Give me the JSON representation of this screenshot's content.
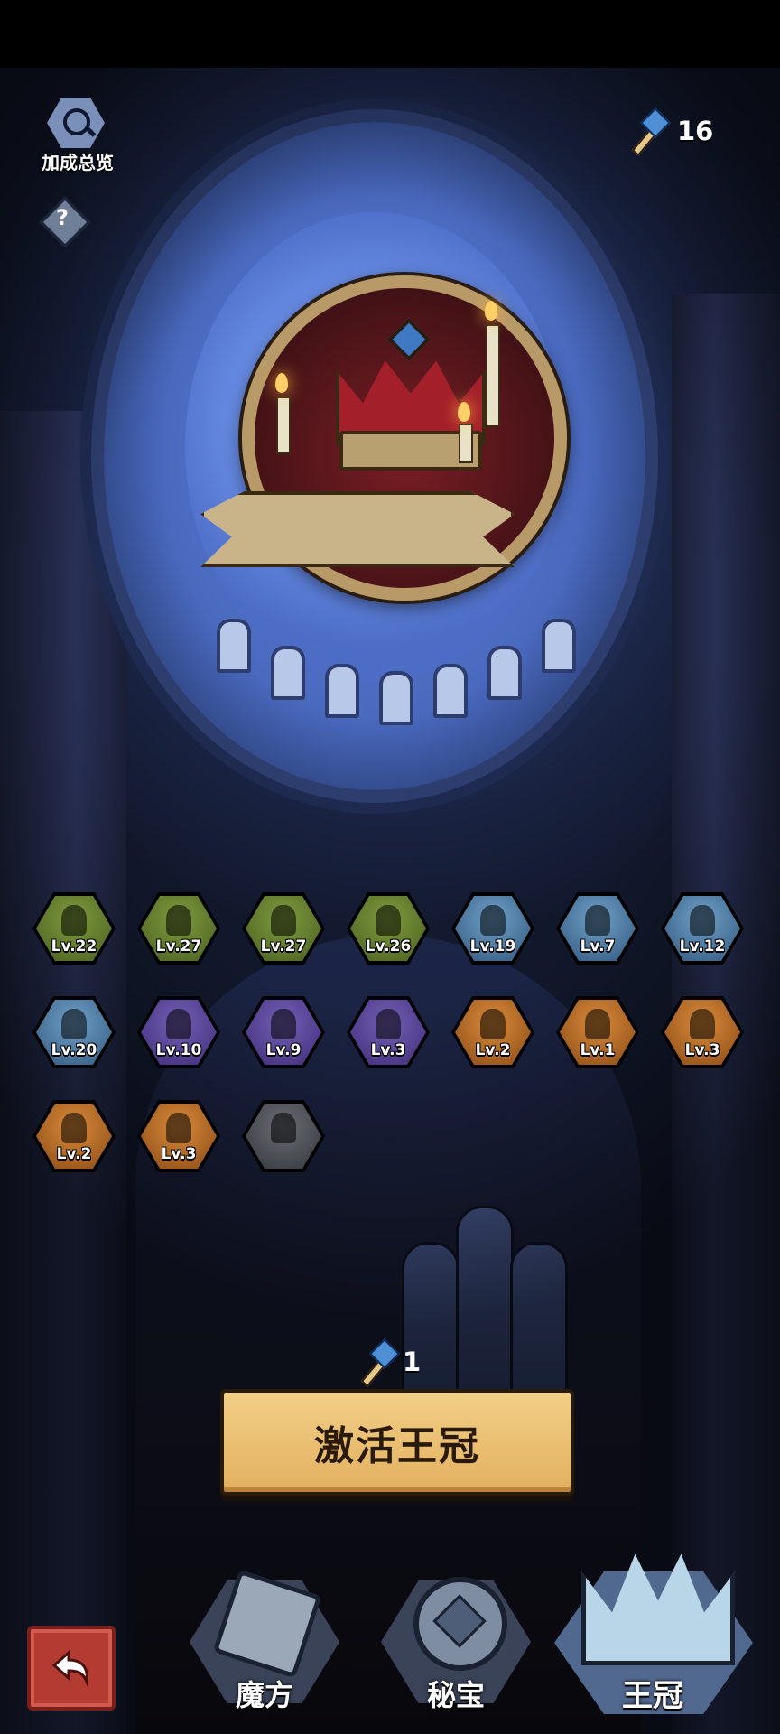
{
  "header": {
    "overview_label": "加成总览",
    "help_label": "?",
    "currency_icon": "gem-wand-icon",
    "currency_value": "16"
  },
  "crown": {
    "art": "royal-crown-with-candles"
  },
  "relics": [
    {
      "level": "Lv.22",
      "tier": "green",
      "icon": "ghost-figure-icon"
    },
    {
      "level": "Lv.27",
      "tier": "green",
      "icon": "bone-icon"
    },
    {
      "level": "Lv.27",
      "tier": "green",
      "icon": "top-hat-figure-icon"
    },
    {
      "level": "Lv.26",
      "tier": "green",
      "icon": "penguin-icon"
    },
    {
      "level": "Lv.19",
      "tier": "blue",
      "icon": "rabbit-icon"
    },
    {
      "level": "Lv.7",
      "tier": "blue",
      "icon": "goblin-head-icon"
    },
    {
      "level": "Lv.12",
      "tier": "blue",
      "icon": "armored-helmet-icon"
    },
    {
      "level": "Lv.20",
      "tier": "blue",
      "icon": "chicken-leg-icon"
    },
    {
      "level": "Lv.10",
      "tier": "purple",
      "icon": "horned-helmet-icon"
    },
    {
      "level": "Lv.9",
      "tier": "purple",
      "icon": "magic-hat-icon"
    },
    {
      "level": "Lv.3",
      "tier": "purple",
      "icon": "rabbit-ears-icon"
    },
    {
      "level": "Lv.2",
      "tier": "orange",
      "icon": "octopus-icon"
    },
    {
      "level": "Lv.1",
      "tier": "orange",
      "icon": "flame-icon"
    },
    {
      "level": "Lv.3",
      "tier": "orange",
      "icon": "beast-icon"
    },
    {
      "level": "Lv.2",
      "tier": "orange",
      "icon": "bat-icon"
    },
    {
      "level": "Lv.3",
      "tier": "orange",
      "icon": "crown-icon"
    },
    {
      "level": "",
      "tier": "gray",
      "icon": "blob-creature-icon"
    }
  ],
  "activation": {
    "cost_icon": "gem-wand-icon",
    "cost_value": "1",
    "button_label": "激活王冠"
  },
  "bottom_nav": {
    "back_icon": "return-arrow-icon",
    "tabs": [
      {
        "label": "魔方",
        "icon": "cube-icon",
        "active": false
      },
      {
        "label": "秘宝",
        "icon": "treasure-gem-icon",
        "active": false
      },
      {
        "label": "王冠",
        "icon": "crown-icon",
        "active": true
      }
    ]
  },
  "colors": {
    "tier_green": "#6a8436",
    "tier_blue": "#4f7fa8",
    "tier_purple": "#5a46a0",
    "tier_orange": "#c2732a",
    "tier_gray": "#55585f",
    "button_gold": "#ecc173",
    "back_red": "#b43b32"
  }
}
